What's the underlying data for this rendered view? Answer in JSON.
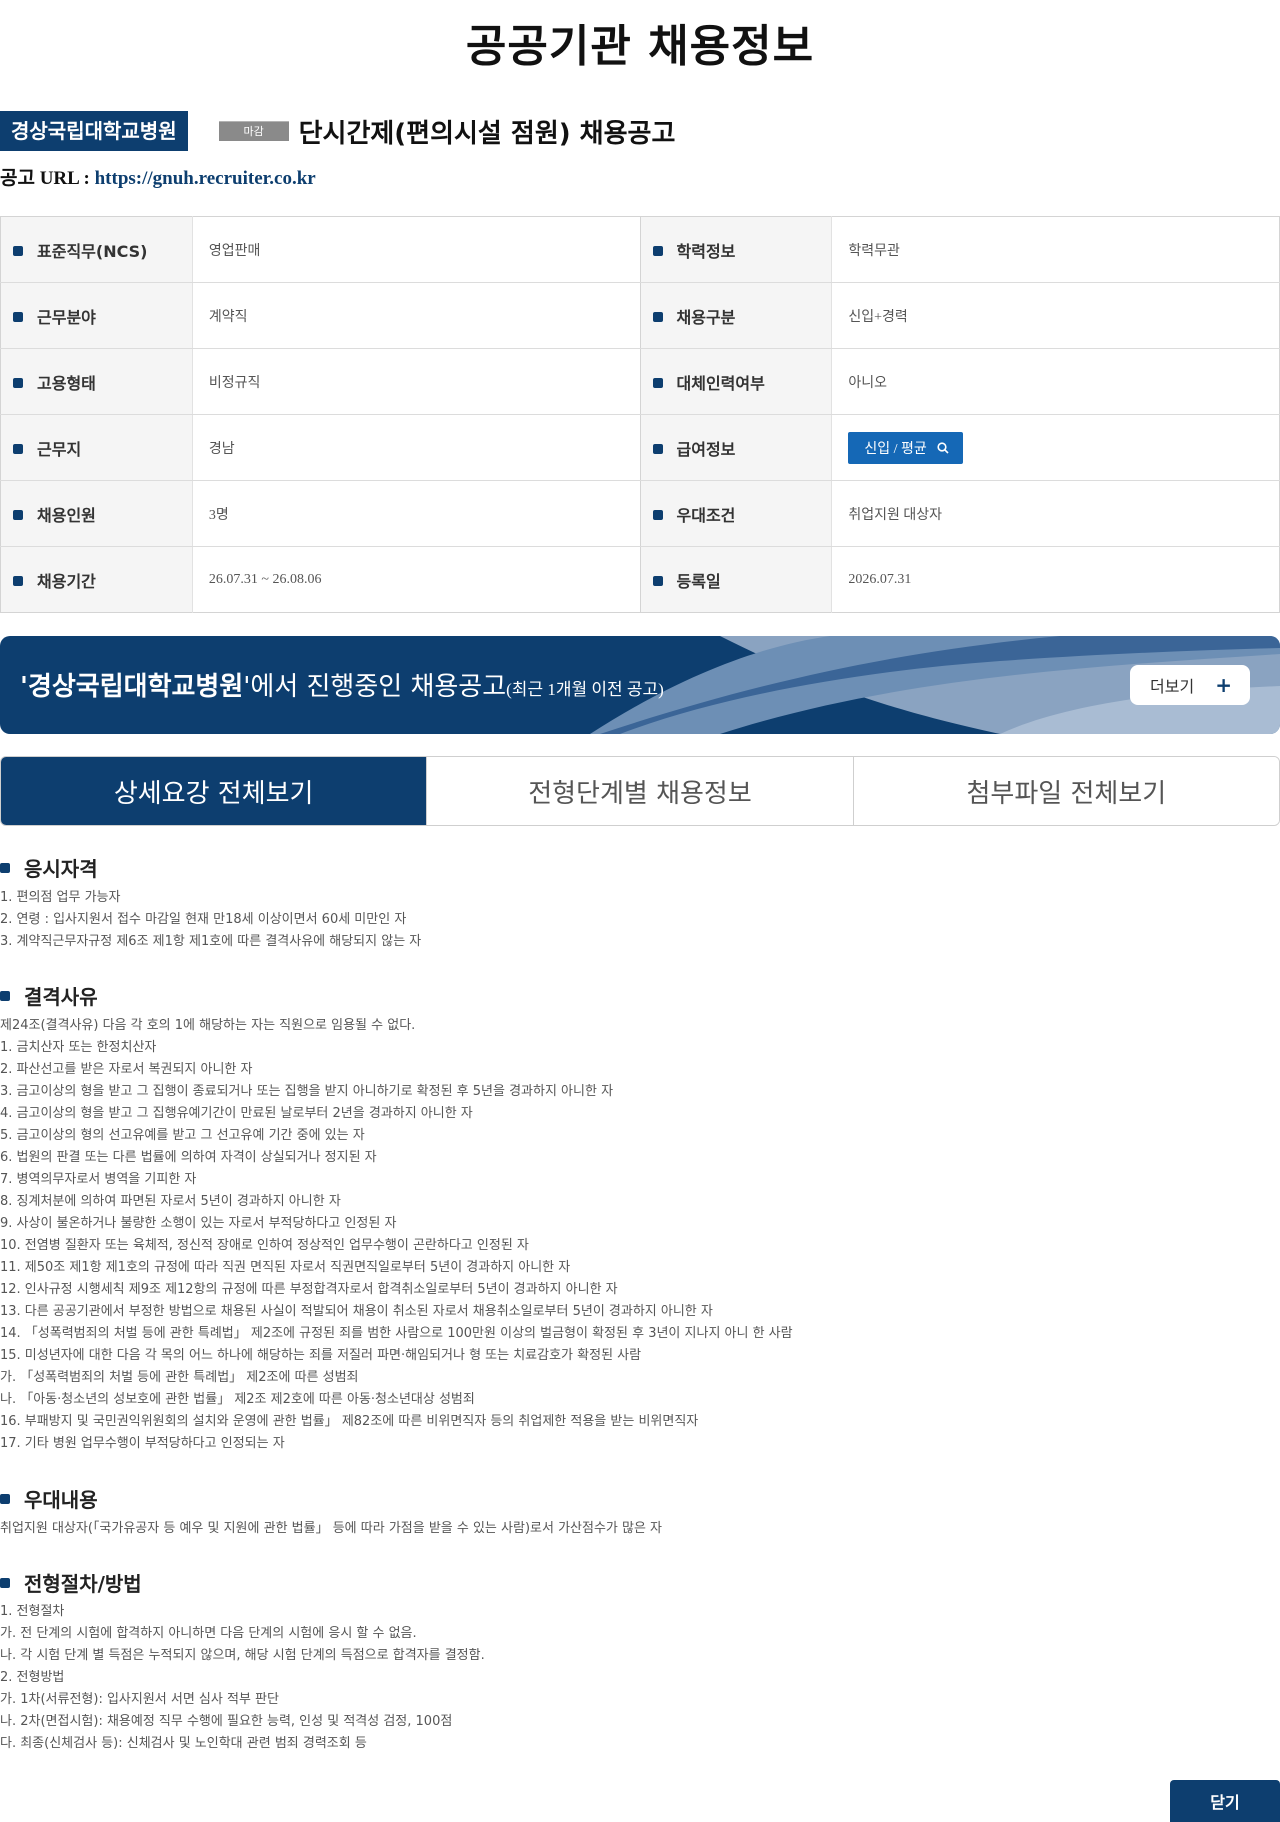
{
  "page_title": "공공기관 채용정보",
  "org_name": "경상국립대학교병원",
  "status": "마감",
  "job_title": "단시간제(편의시설 점원) 채용공고",
  "url_label": "공고 URL : ",
  "url": "https://gnuh.recruiter.co.kr",
  "info": [
    {
      "l1": "표준직무(NCS)",
      "v1": "영업판매",
      "l2": "학력정보",
      "v2": "학력무관"
    },
    {
      "l1": "근무분야",
      "v1": "계약직",
      "l2": "채용구분",
      "v2": "신입+경력"
    },
    {
      "l1": "고용형태",
      "v1": "비정규직",
      "l2": "대체인력여부",
      "v2": "아니오"
    },
    {
      "l1": "근무지",
      "v1": "경남",
      "l2": "급여정보",
      "v2": "신입 / 평균"
    },
    {
      "l1": "채용인원",
      "v1": "3명",
      "l2": "우대조건",
      "v2": "취업지원 대상자"
    },
    {
      "l1": "채용기간",
      "v1": "26.07.31 ~ 26.08.06",
      "l2": "등록일",
      "v2": "2026.07.31"
    }
  ],
  "banner": {
    "quote_open": "'",
    "org": "경상국립대학교병원",
    "text": "'에서 진행중인 채용공고",
    "small": "(최근 1개월 이전 공고)",
    "more": "더보기",
    "more_symbol": "+"
  },
  "tabs": [
    "상세요강 전체보기",
    "전형단계별 채용정보",
    "첨부파일 전체보기"
  ],
  "sections": [
    {
      "title": "응시자격",
      "lines": [
        "1. 편의점 업무 가능자",
        "2. 연령 : 입사지원서 접수 마감일 현재 만18세 이상이면서 60세 미만인 자",
        "3. 계약직근무자규정 제6조 제1항 제1호에 따른 결격사유에 해당되지 않는 자"
      ]
    },
    {
      "title": "결격사유",
      "lines": [
        "제24조(결격사유) 다음 각 호의 1에 해당하는 자는 직원으로 임용될 수 없다.",
        "1. 금치산자 또는 한정치산자",
        "2. 파산선고를 받은 자로서 복권되지 아니한 자",
        "3. 금고이상의 형을 받고 그 집행이 종료되거나 또는 집행을 받지 아니하기로 확정된 후 5년을 경과하지 아니한 자",
        "4. 금고이상의 형을 받고 그 집행유예기간이 만료된 날로부터 2년을 경과하지 아니한 자",
        "5. 금고이상의 형의 선고유예를 받고 그 선고유예 기간 중에 있는 자",
        "6. 법원의 판결 또는 다른 법률에 의하여 자격이 상실되거나 정지된 자",
        "7. 병역의무자로서 병역을 기피한 자",
        "8. 징계처분에 의하여 파면된 자로서 5년이 경과하지 아니한 자",
        "9. 사상이 불온하거나 불량한 소행이 있는 자로서 부적당하다고 인정된 자",
        "10. 전염병 질환자 또는 육체적, 정신적 장애로 인하여 정상적인 업무수행이 곤란하다고 인정된 자",
        "11. 제50조 제1항 제1호의 규정에 따라 직권 면직된 자로서 직권면직일로부터 5년이 경과하지 아니한 자",
        "12. 인사규정 시행세칙 제9조 제12항의 규정에 따른 부정합격자로서 합격취소일로부터 5년이 경과하지 아니한 자",
        "13. 다른 공공기관에서 부정한 방법으로 채용된 사실이 적발되어 채용이 취소된 자로서 채용취소일로부터 5년이 경과하지 아니한 자",
        "14. 「성폭력범죄의 처벌 등에 관한 특례법」 제2조에 규정된 죄를 범한 사람으로 100만원 이상의 벌금형이 확정된 후 3년이 지나지 아니 한 사람",
        "15. 미성년자에 대한 다음 각 목의 어느 하나에 해당하는 죄를 저질러 파면·해임되거나 형 또는 치료감호가 확정된 사람",
        "가. 「성폭력범죄의 처벌 등에 관한 특례법」 제2조에 따른 성범죄",
        "나. 「아동·청소년의 성보호에 관한 법률」 제2조 제2호에 따른 아동·청소년대상 성범죄",
        "16. 부패방지 및 국민권익위원회의 설치와 운영에 관한 법률」 제82조에 따른 비위면직자 등의 취업제한 적용을 받는 비위면직자",
        "17. 기타 병원 업무수행이 부적당하다고 인정되는 자"
      ]
    },
    {
      "title": "우대내용",
      "lines": [
        "취업지원 대상자(「국가유공자 등 예우 및 지원에 관한 법률」 등에 따라 가점을 받을 수 있는 사람)로서 가산점수가 많은 자"
      ]
    },
    {
      "title": "전형절차/방법",
      "lines": [
        "1. 전형절차",
        "가. 전 단계의 시험에 합격하지 아니하면 다음 단계의 시험에 응시 할 수 없음.",
        "나. 각 시험 단계 별 득점은 누적되지 않으며, 해당 시험 단계의 득점으로 합격자를 결정함.",
        "2. 전형방법",
        "가. 1차(서류전형): 입사지원서 서면 심사 적부 판단",
        "나. 2차(면접시험): 채용예정 직무 수행에 필요한 능력, 인성 및 적격성 검정, 100점",
        "다. 최종(신체검사 등): 신체검사 및 노인학대 관련 범죄 경력조회 등"
      ]
    }
  ],
  "close_label": "닫기",
  "colors": {
    "navy": "#0d3e6f",
    "blue_button": "#1568b6",
    "label_bg": "#f5f5f5"
  },
  "icons": {
    "section_bullet": "square-bullet-icon",
    "salary": "search-icon",
    "more": "plus-icon"
  }
}
